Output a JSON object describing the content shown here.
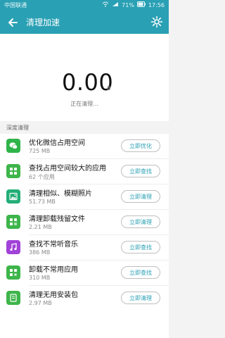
{
  "status_bar": {
    "carrier": "中国联通",
    "icons": [
      "sim-icon",
      "wifi-icon",
      "signal-icon",
      "battery-icon"
    ],
    "battery": "71%",
    "time": "17:56"
  },
  "app_bar": {
    "title": "清理加速",
    "icons": {
      "back": "back-arrow-icon",
      "settings": "gear-icon"
    }
  },
  "hero": {
    "amount": "0.00",
    "unit": "B",
    "status": "正在清理..."
  },
  "section": {
    "title": "深度清理"
  },
  "items": [
    {
      "label": "优化微信占用空间",
      "size": "725 MB",
      "button": "立即优化",
      "icon": "wechat-icon",
      "color": "#2fb44a"
    },
    {
      "label": "查找占用空间较大的应用",
      "size": "62 个应用",
      "button": "立即查找",
      "icon": "apps-grid-icon",
      "color": "#3db54a"
    },
    {
      "label": "清理相似、模糊照片",
      "size": "51.73 MB",
      "button": "立即清理",
      "icon": "photo-icon",
      "color": "#22ae77"
    },
    {
      "label": "清理卸载残留文件",
      "size": "2.21 MB",
      "button": "立即清理",
      "icon": "residual-files-icon",
      "color": "#3db54a"
    },
    {
      "label": "查找不常听音乐",
      "size": "386 MB",
      "button": "立即查找",
      "icon": "music-icon",
      "color": "#a142d8"
    },
    {
      "label": "卸载不常用应用",
      "size": "310 MB",
      "button": "立即查找",
      "icon": "uninstall-apps-icon",
      "color": "#3db54a"
    },
    {
      "label": "清理无用安装包",
      "size": "2.97 MB",
      "button": "立即清理",
      "icon": "package-icon",
      "color": "#3db54a"
    }
  ]
}
